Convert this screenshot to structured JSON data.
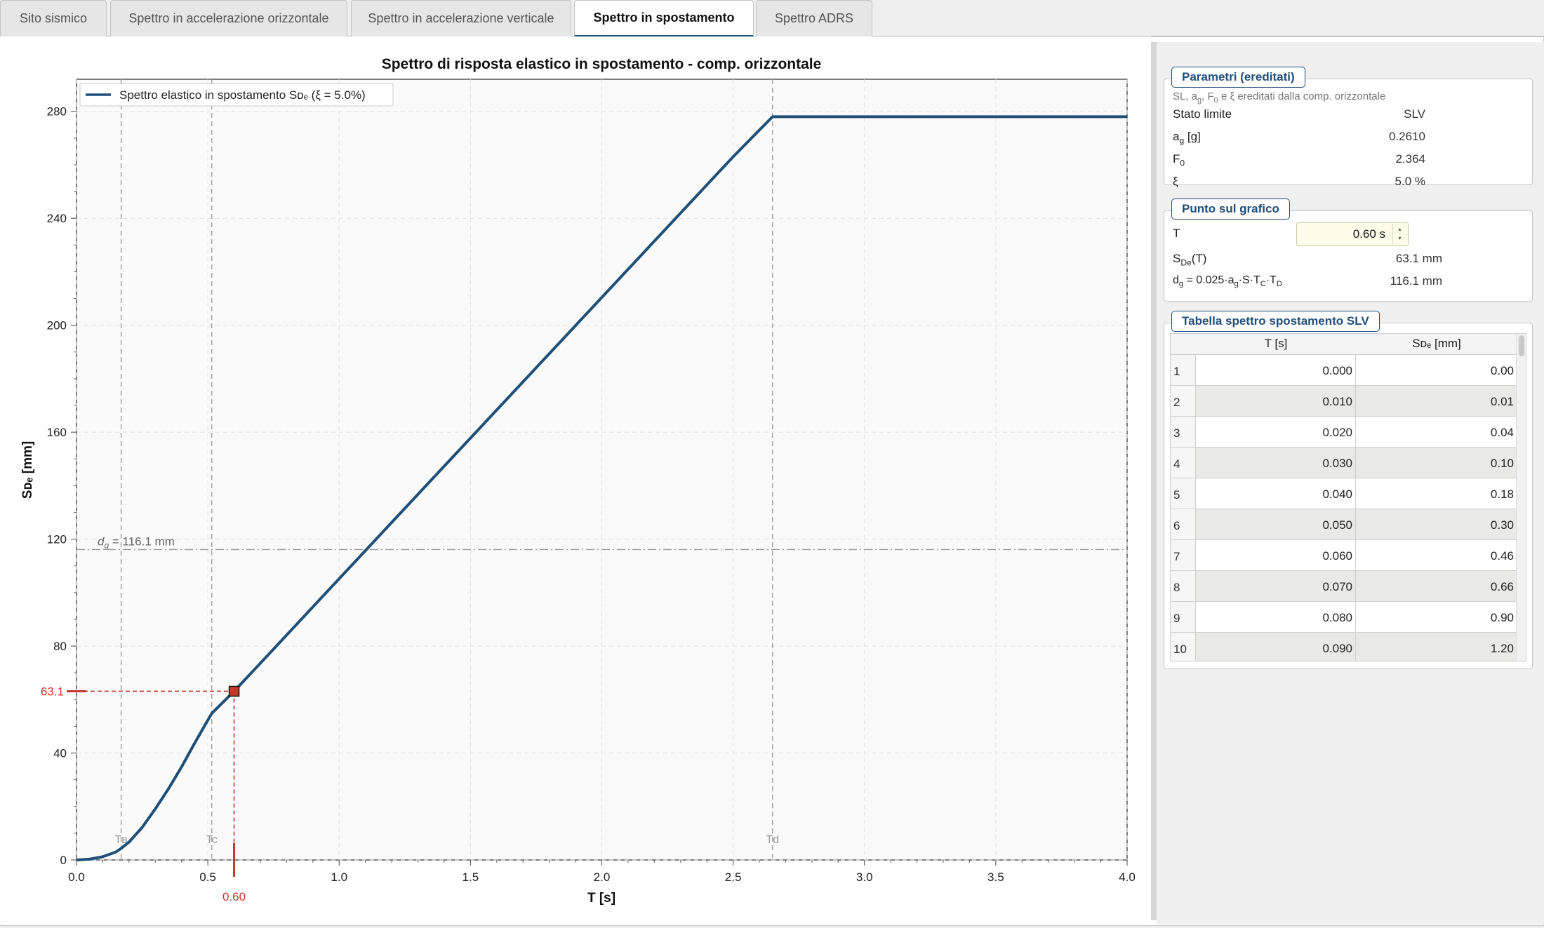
{
  "tabs": [
    {
      "label": "Sito sismico",
      "active": false
    },
    {
      "label": "Spettro in accelerazione orizzontale",
      "active": false
    },
    {
      "label": "Spettro in accelerazione verticale",
      "active": false
    },
    {
      "label": "Spettro in spostamento",
      "active": true
    },
    {
      "label": "Spettro ADRS",
      "active": false
    }
  ],
  "chart_data": {
    "type": "line",
    "title": "Spettro di risposta elastico in spostamento - comp. orizzontale",
    "xlabel": "T [s]",
    "ylabel": "Sᴅₑ [mm]",
    "xlim": [
      0,
      4.0
    ],
    "ylim": [
      0,
      292
    ],
    "xticks": [
      "0.0",
      "0.5",
      "1.0",
      "1.5",
      "2.0",
      "2.5",
      "3.0",
      "3.5",
      "4.0"
    ],
    "yticks": [
      "0",
      "40",
      "80",
      "120",
      "160",
      "200",
      "240",
      "280"
    ],
    "grid": true,
    "legend_position": "top-left",
    "series": [
      {
        "name": "Spettro elastico in spostamento Sᴅₑ (ξ = 5.0%)",
        "color": "#1f4e79",
        "x": [
          0,
          0.05,
          0.1,
          0.15,
          0.17,
          0.2,
          0.25,
          0.3,
          0.35,
          0.4,
          0.45,
          0.5,
          0.515,
          0.6,
          0.7,
          0.8,
          1.0,
          1.5,
          2.0,
          2.5,
          2.65,
          3.0,
          3.5,
          4.0
        ],
        "y": [
          0,
          0.3,
          1.2,
          3.0,
          4.3,
          6.7,
          12.2,
          19.1,
          26.6,
          34.8,
          43.7,
          52.3,
          54.8,
          63.1,
          73.6,
          84.1,
          105.2,
          157.8,
          210.4,
          263.0,
          278.0,
          278.0,
          278.0,
          278.0
        ]
      }
    ],
    "vlines": [
      {
        "label": "Tʙ",
        "x": 0.17,
        "color": "#999999"
      },
      {
        "label": "Tc",
        "x": 0.515,
        "color": "#999999"
      },
      {
        "label": "Td",
        "x": 2.65,
        "color": "#999999"
      }
    ],
    "hline": {
      "label": "d",
      "sub": "g",
      "suffix": " = 116.1 mm",
      "y": 116.1,
      "color": "#999999"
    },
    "marker": {
      "x": 0.6,
      "y": 63.1,
      "x_label": "0.60",
      "y_label": "63.1",
      "color": "#c0392b"
    },
    "colors": {
      "series": "#1f4e79",
      "marker": "#c0392b",
      "guide": "#9a9a9a"
    }
  },
  "params": {
    "title": "Parametri (ereditati)",
    "note": "SL, ag, F0 e ξ ereditati dalla comp. orizzontale",
    "rows": [
      {
        "label": "Stato limite",
        "value": "SLV"
      },
      {
        "label": "ag [g]",
        "value": "0.2610"
      },
      {
        "label": "F0",
        "value": "2.364"
      },
      {
        "label": "ξ",
        "value": "5.0 %"
      }
    ]
  },
  "point": {
    "title": "Punto sul grafico",
    "t_label": "T",
    "t_value": "0.60 s",
    "sde_label": "SDe(T)",
    "sde_value": "63.1 mm",
    "dg_label": "dg = 0.025·ag·S·TC·TD",
    "dg_value": "116.1 mm"
  },
  "table": {
    "title": "Tabella spettro spostamento SLV",
    "headers": [
      "T [s]",
      "Sᴅₑ [mm]"
    ],
    "rows": [
      [
        "1",
        "0.000",
        "0.00"
      ],
      [
        "2",
        "0.010",
        "0.01"
      ],
      [
        "3",
        "0.020",
        "0.04"
      ],
      [
        "4",
        "0.030",
        "0.10"
      ],
      [
        "5",
        "0.040",
        "0.18"
      ],
      [
        "6",
        "0.050",
        "0.30"
      ],
      [
        "7",
        "0.060",
        "0.46"
      ],
      [
        "8",
        "0.070",
        "0.66"
      ],
      [
        "9",
        "0.080",
        "0.90"
      ],
      [
        "10",
        "0.090",
        "1.20"
      ]
    ]
  }
}
